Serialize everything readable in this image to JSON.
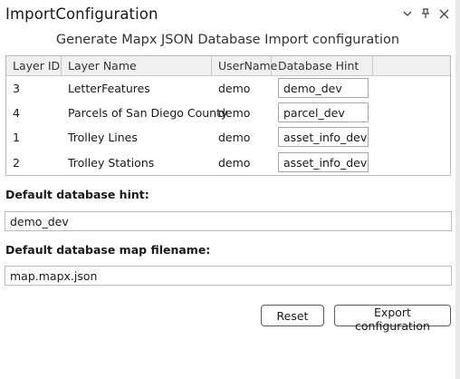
{
  "window": {
    "title": "ImportConfiguration",
    "controls": [
      {
        "name": "options-chevron-icon"
      },
      {
        "name": "pin-icon"
      },
      {
        "name": "close-icon"
      }
    ]
  },
  "heading": "Generate Mapx JSON Database Import configuration",
  "table": {
    "columns": [
      "Layer ID",
      "Layer Name",
      "UserName",
      "Database Hint"
    ],
    "rows": [
      {
        "layer_id": "3",
        "layer_name": "LetterFeatures",
        "username": "demo",
        "database_hint": "demo_dev"
      },
      {
        "layer_id": "4",
        "layer_name": "Parcels of San Diego County",
        "username": "demo",
        "database_hint": "parcel_dev"
      },
      {
        "layer_id": "1",
        "layer_name": "Trolley Lines",
        "username": "demo",
        "database_hint": "asset_info_dev"
      },
      {
        "layer_id": "2",
        "layer_name": "Trolley Stations",
        "username": "demo",
        "database_hint": "asset_info_dev"
      }
    ]
  },
  "default_hint": {
    "label": "Default database hint:",
    "value": "demo_dev"
  },
  "default_filename": {
    "label": "Default database map filename:",
    "value": "map.mapx.json"
  },
  "buttons": {
    "reset": "Reset",
    "export": "Export configuration"
  }
}
